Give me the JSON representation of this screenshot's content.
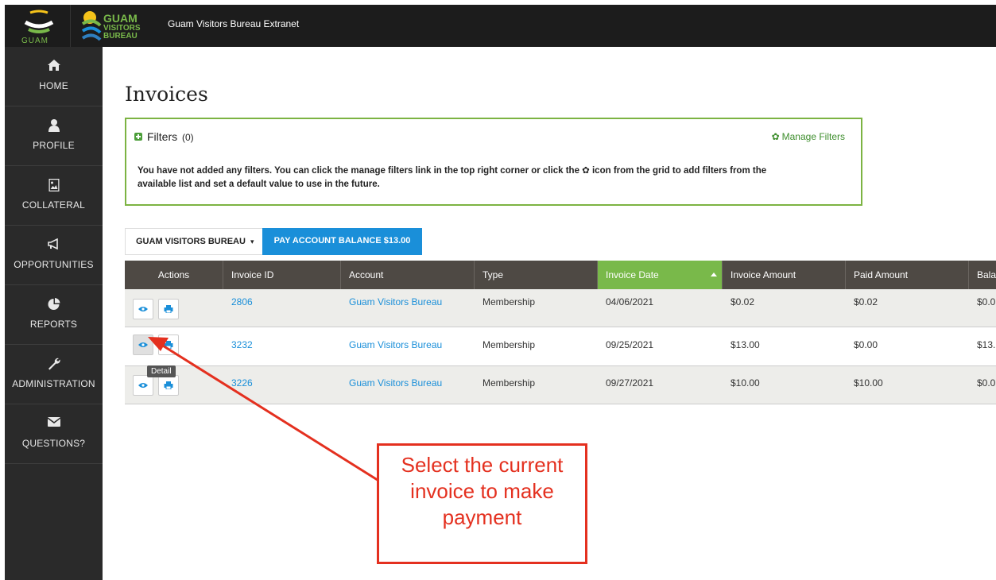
{
  "header": {
    "title": "Guam Visitors Bureau Extranet",
    "guam_logo_text": "GUAM",
    "gvb_logo_text": [
      "GUAM",
      "VISITORS",
      "BUREAU"
    ]
  },
  "sidebar": {
    "items": [
      {
        "label": "HOME",
        "icon": "home-icon"
      },
      {
        "label": "PROFILE",
        "icon": "user-icon"
      },
      {
        "label": "COLLATERAL",
        "icon": "image-file-icon"
      },
      {
        "label": "OPPORTUNITIES",
        "icon": "megaphone-icon"
      },
      {
        "label": "REPORTS",
        "icon": "pie-chart-icon"
      },
      {
        "label": "ADMINISTRATION",
        "icon": "wrench-icon"
      },
      {
        "label": "QUESTIONS?",
        "icon": "envelope-icon"
      }
    ]
  },
  "page": {
    "title": "Invoices"
  },
  "filters": {
    "label": "Filters",
    "count": "(0)",
    "manage_label": "Manage Filters",
    "message_line1": "You have not added any filters. You can click the manage filters link in the top right corner or click the ✿ icon from the grid to add filters from the",
    "message_line2": "available list and set a default value to use in the future."
  },
  "toolbar": {
    "account_select": "GUAM VISITORS BUREAU",
    "pay_button": "PAY ACCOUNT BALANCE $13.00"
  },
  "grid": {
    "columns": [
      "Actions",
      "Invoice ID",
      "Account",
      "Type",
      "Invoice Date",
      "Invoice Amount",
      "Paid Amount",
      "Bala"
    ],
    "rows": [
      {
        "id": "2806",
        "account": "Guam Visitors Bureau",
        "type": "Membership",
        "date": "04/06/2021",
        "amount": "$0.02",
        "paid": "$0.02",
        "balance": "$0.0"
      },
      {
        "id": "3232",
        "account": "Guam Visitors Bureau",
        "type": "Membership",
        "date": "09/25/2021",
        "amount": "$13.00",
        "paid": "$0.00",
        "balance": "$13."
      },
      {
        "id": "3226",
        "account": "Guam Visitors Bureau",
        "type": "Membership",
        "date": "09/27/2021",
        "amount": "$10.00",
        "paid": "$10.00",
        "balance": "$0.0"
      }
    ]
  },
  "tooltip": "Detail",
  "callout": {
    "lines": [
      "Select the current",
      "invoice to make",
      "payment"
    ]
  },
  "colors": {
    "brand_green": "#7cb342",
    "link_blue": "#1a8fd9",
    "annotation_red": "#e4301f",
    "header_dark": "#4e4944"
  }
}
